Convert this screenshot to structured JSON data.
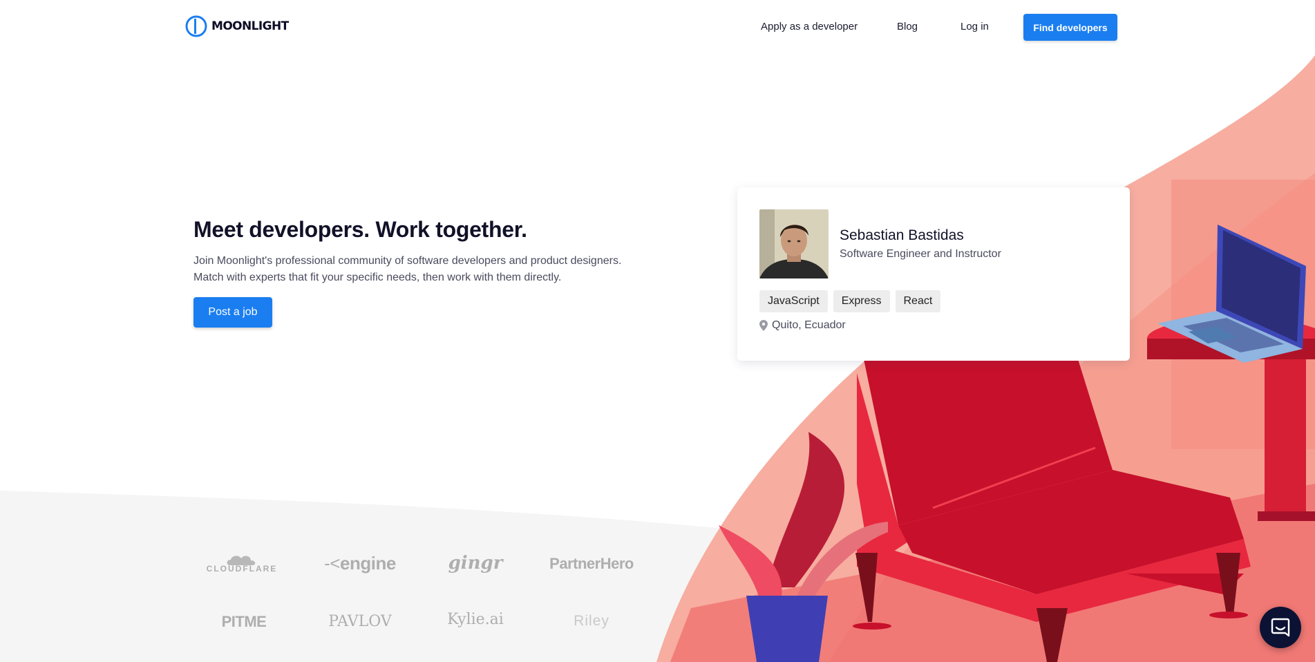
{
  "header": {
    "brand": "MOONLIGHT",
    "nav": {
      "apply": "Apply as a developer",
      "blog": "Blog",
      "login": "Log in",
      "find": "Find developers"
    }
  },
  "hero": {
    "title": "Meet developers. Work together.",
    "subtitle_line1": "Join Moonlight's professional community of software developers and product designers.",
    "subtitle_line2": "Match with experts that fit your specific needs, then work with them directly.",
    "cta": "Post a job"
  },
  "profile_card": {
    "name": "Sebastian Bastidas",
    "role": "Software Engineer and Instructor",
    "skills": [
      "JavaScript",
      "Express",
      "React"
    ],
    "location": "Quito, Ecuador"
  },
  "clients": {
    "row1": [
      "CLOUDFLARE",
      "engine",
      "gingr",
      "PartnerHero"
    ],
    "row2": [
      "PITME",
      "PAVLOV",
      "Kylie.ai",
      "Riley"
    ]
  },
  "colors": {
    "accent": "#1a7ef0",
    "illustration_red": "#e8283f",
    "illustration_pink": "#f6a99a",
    "logo_gray": "#aeaeae",
    "chat_navy": "#0c1233"
  },
  "icons": {
    "logo": "moonlight-logo-icon",
    "location": "map-pin-icon",
    "chat": "chat-icon"
  }
}
